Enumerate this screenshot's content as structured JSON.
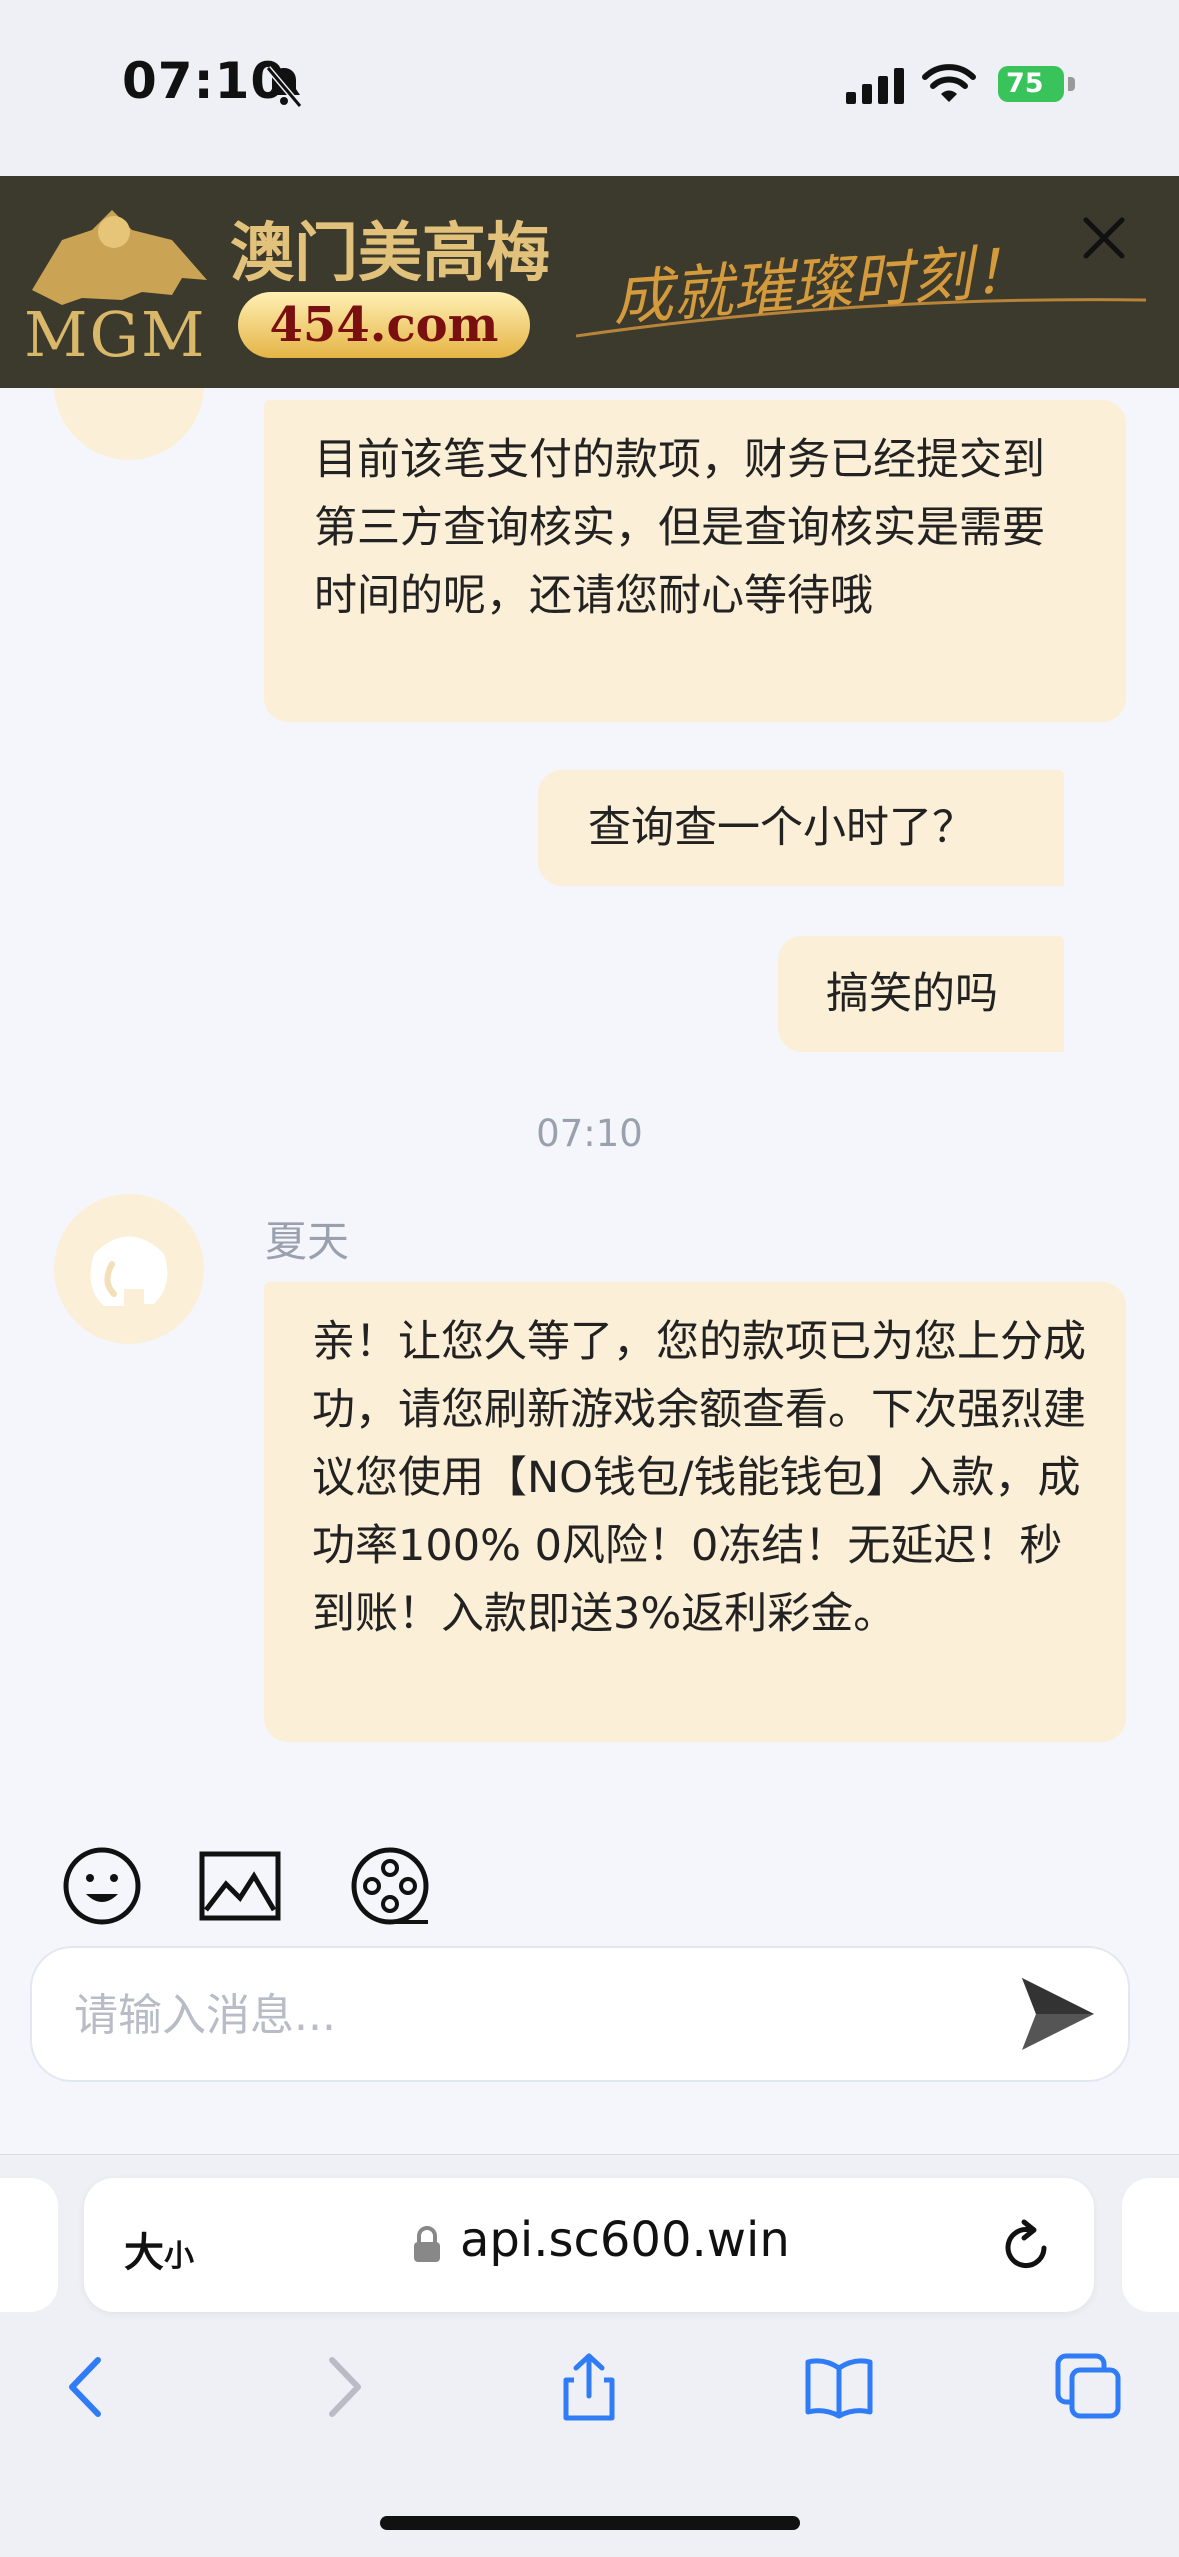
{
  "status_bar": {
    "time": "07:10",
    "battery_percent": "75",
    "icons": [
      "bell-muted-icon",
      "signal-icon",
      "wifi-icon",
      "battery-charging-icon"
    ]
  },
  "banner": {
    "brand": "MGM",
    "chinese_name": "澳门美高梅",
    "domain": "454.com",
    "slogan": "成就璀璨时刻！",
    "close_icon": "close-icon"
  },
  "chat": {
    "messages": [
      {
        "side": "left",
        "text": "目前该笔支付的款项，财务已经提交到第三方查询核实，但是查询核实是需要时间的呢，还请您耐心等待哦"
      },
      {
        "side": "right",
        "text": "查询查一个小时了？"
      },
      {
        "side": "right",
        "text": "搞笑的吗"
      },
      {
        "side": "left",
        "text": "亲！让您久等了，您的款项已为您上分成功，请您刷新游戏余额查看。下次强烈建议您使用【NO钱包/钱能钱包】入款，成功率100% 0风险！0冻结！无延迟！秒到账！入款即送3%返利彩金。"
      }
    ],
    "time_separator": "07:10",
    "sender_name": "夏天"
  },
  "composer": {
    "placeholder": "请输入消息...",
    "tools": [
      "emoji-icon",
      "image-icon",
      "video-reel-icon"
    ],
    "send_icon": "send-icon"
  },
  "browser": {
    "text_size_label_big": "大",
    "text_size_label_small": "小",
    "url": "api.sc600.win",
    "nav": [
      "back-icon",
      "forward-icon",
      "share-icon",
      "bookmarks-icon",
      "tabs-icon"
    ]
  },
  "colors": {
    "bubble": "#fcefd7",
    "banner_bg": "#3b3a2c",
    "accent_blue": "#2f7cf6",
    "battery_green": "#38c45a"
  }
}
